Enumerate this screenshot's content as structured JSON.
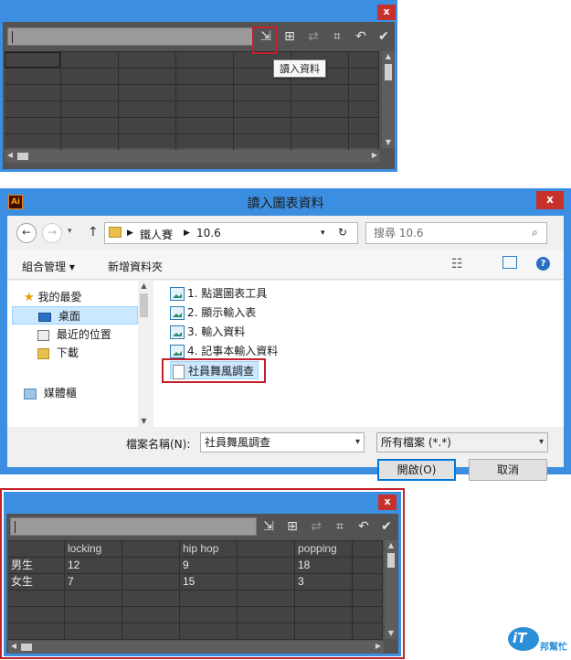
{
  "top_panel": {
    "close_label": "x",
    "tooltip": "讀入資料",
    "toolbar_icons": [
      "import-data-icon",
      "transpose-icon",
      "switch-xy-icon",
      "cell-style-icon",
      "revert-icon",
      "apply-icon"
    ]
  },
  "dialog": {
    "title": "讀入圖表資料",
    "app_badge": "Ai",
    "close_label": "x",
    "breadcrumb": [
      "鐵人賽",
      "10.6"
    ],
    "search_placeholder": "搜尋 10.6",
    "organize_label": "組合管理 ▾",
    "new_folder_label": "新增資料夾",
    "nav": {
      "favorites": "我的最愛",
      "desktop": "桌面",
      "recent": "最近的位置",
      "downloads": "下載",
      "libraries": "媒體櫃"
    },
    "files": [
      {
        "name": "1. 點選圖表工具"
      },
      {
        "name": "2. 顯示輸入表"
      },
      {
        "name": "3. 輸入資料"
      },
      {
        "name": "4. 記事本輸入資料"
      },
      {
        "name": "社員舞風調查"
      }
    ],
    "filename_label": "檔案名稱(N):",
    "filename_value": "社員舞風調查",
    "filetype_value": "所有檔案 (*.*)",
    "open_label": "開啟(O)",
    "cancel_label": "取消"
  },
  "bottom_panel": {
    "close_label": "x",
    "headers": [
      "",
      "locking",
      "",
      "hip hop",
      "",
      "popping"
    ],
    "rows": [
      [
        "男生",
        "12",
        "",
        "9",
        "",
        "18"
      ],
      [
        "女生",
        "7",
        "",
        "15",
        "",
        "3"
      ]
    ]
  },
  "watermark": {
    "brand": "iT",
    "subtitle": "邦幫忙"
  },
  "colors": {
    "window_frame": "#3c8fe0",
    "highlight": "#c4202b"
  }
}
